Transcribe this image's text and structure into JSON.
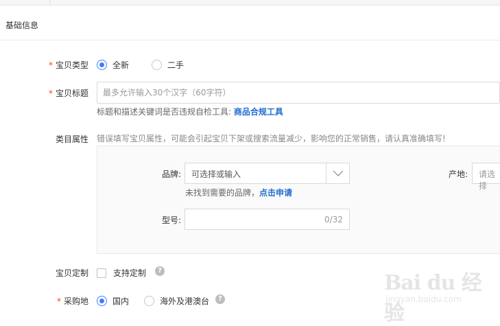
{
  "section": {
    "title": "基础信息"
  },
  "item_type": {
    "required_mark": "*",
    "label": "宝贝类型",
    "options": [
      {
        "label": "全新",
        "selected": true
      },
      {
        "label": "二手",
        "selected": false
      }
    ]
  },
  "item_title": {
    "required_mark": "*",
    "label": "宝贝标题",
    "value": "",
    "placeholder": "最多允许输入30个汉字（60字符）",
    "hint_prefix": "标题和描述关键词是否违规自检工具:",
    "hint_link": "商品合规工具"
  },
  "category_attrs": {
    "label": "类目属性",
    "warning": "错误填写宝贝属性，可能会引起宝贝下架或搜索流量减少，影响您的正常销售，请认真准确填写!",
    "brand": {
      "label": "品牌:",
      "placeholder": "可选择或输入",
      "hint_prefix": "未找到需要的品牌，",
      "hint_link": "点击申请"
    },
    "origin": {
      "label": "产地:",
      "placeholder": "请选择"
    },
    "model": {
      "label": "型号:",
      "value": "",
      "counter": "0/32"
    }
  },
  "customization": {
    "label": "宝贝定制",
    "checkbox_label": "支持定制",
    "checked": false,
    "help": "?"
  },
  "purchase_location": {
    "required_mark": "*",
    "label": "采购地",
    "options": [
      {
        "label": "国内",
        "selected": true
      },
      {
        "label": "海外及港澳台",
        "selected": false
      }
    ],
    "help": "?"
  },
  "watermark": {
    "main": "Bai du 经验",
    "sub": "jingyan.baidu.com"
  },
  "colors": {
    "accent": "#3d7eff",
    "link": "#1f6fd1",
    "required": "#ff4400"
  }
}
